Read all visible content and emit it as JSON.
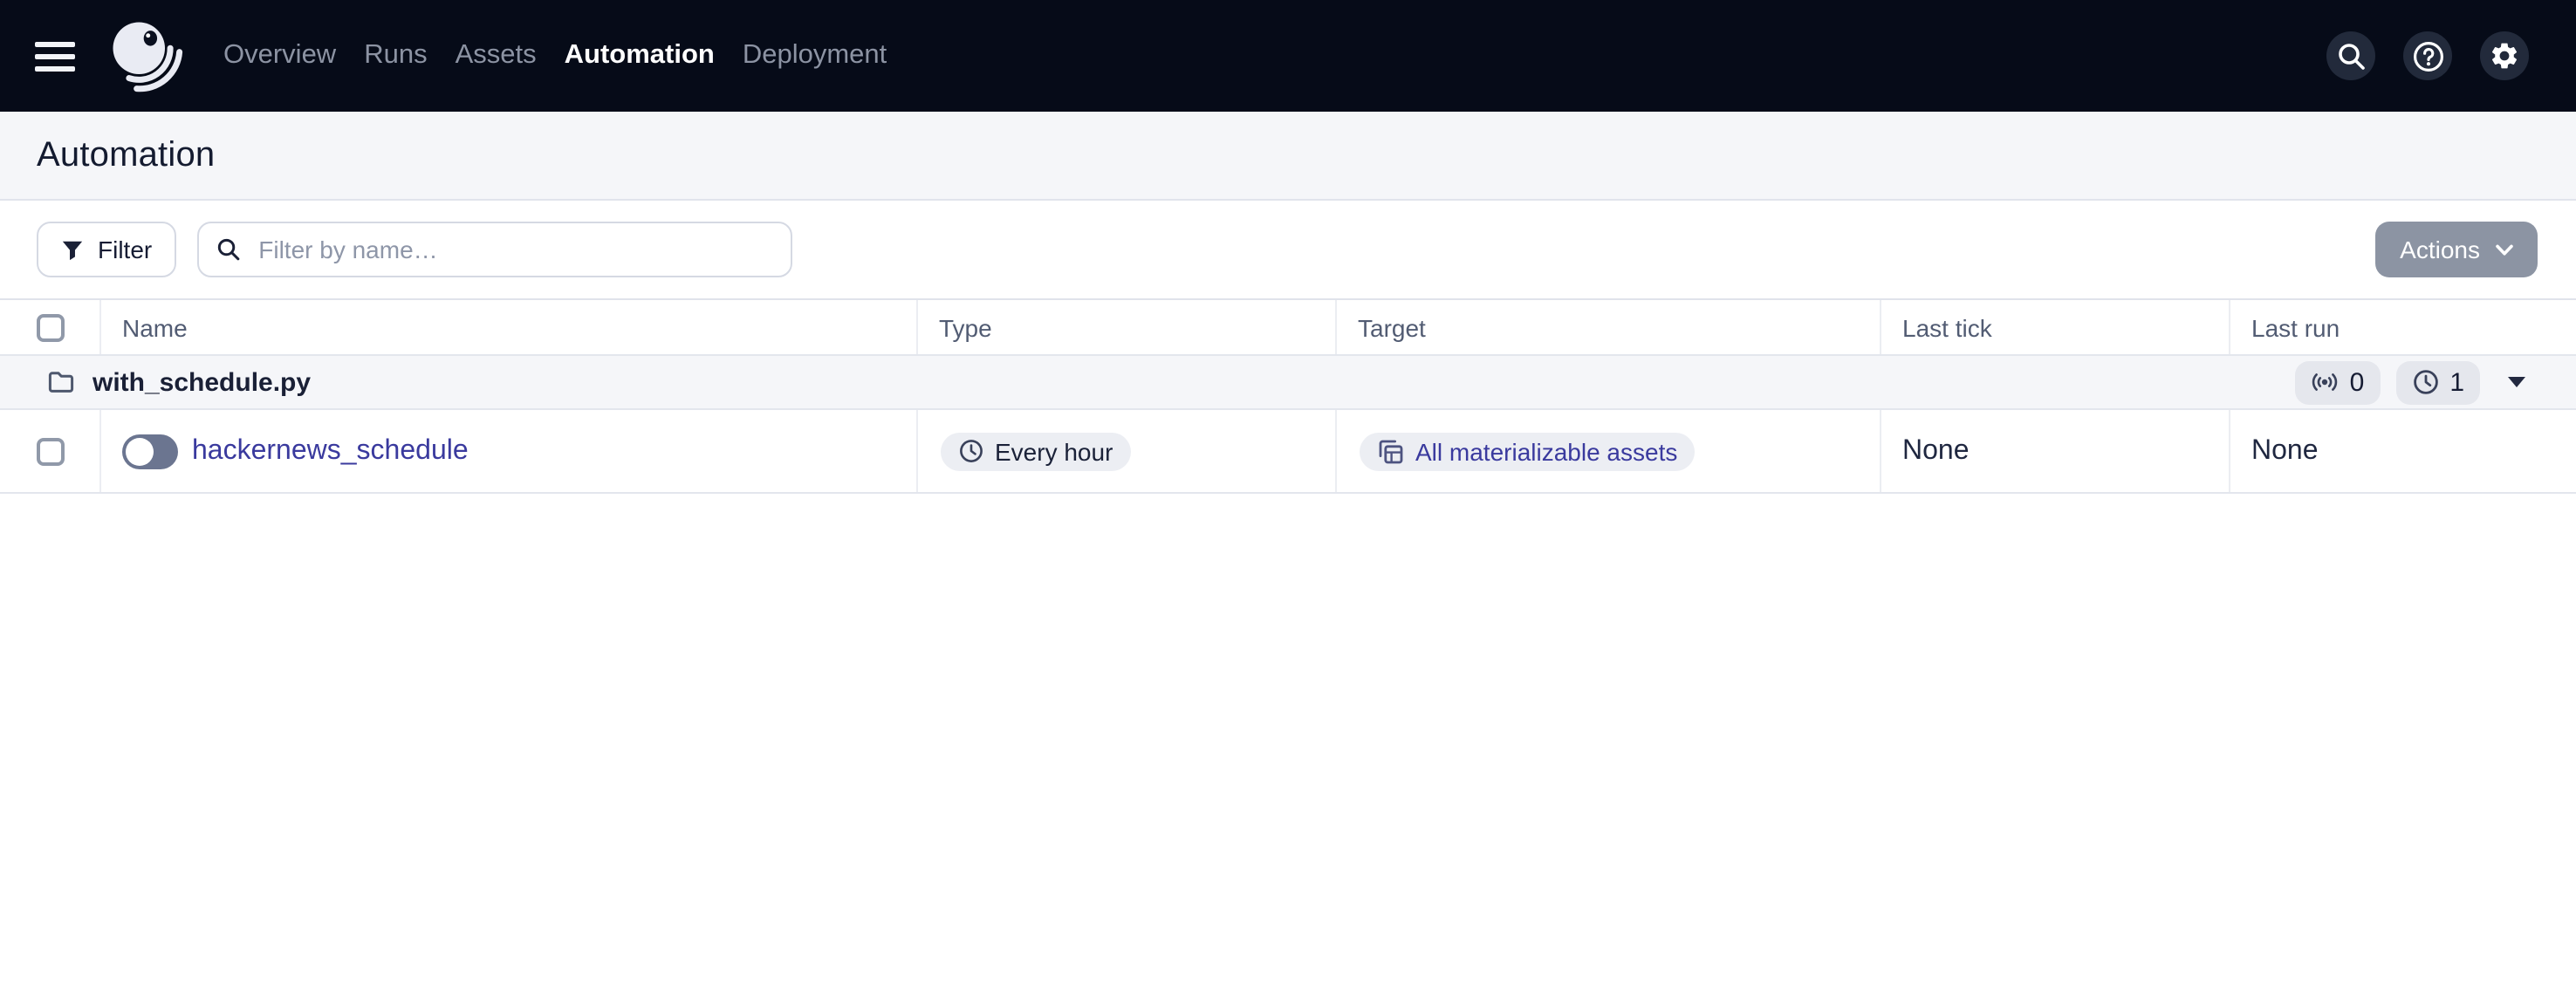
{
  "colors": {
    "topnav_bg": "#060B18",
    "band_bg": "#F5F6F9",
    "link": "#3A3A9E",
    "actions_bg": "#8C94A3",
    "toggle_track": "#6B7590"
  },
  "topnav": {
    "items": [
      {
        "label": "Overview",
        "active": false
      },
      {
        "label": "Runs",
        "active": false
      },
      {
        "label": "Assets",
        "active": false
      },
      {
        "label": "Automation",
        "active": true
      },
      {
        "label": "Deployment",
        "active": false
      }
    ],
    "icon_buttons": [
      "search-icon",
      "help-icon",
      "settings-icon"
    ]
  },
  "page": {
    "title": "Automation"
  },
  "toolbar": {
    "filter_label": "Filter",
    "search_placeholder": "Filter by name…",
    "search_value": "",
    "actions_label": "Actions"
  },
  "table": {
    "columns": [
      "",
      "Name",
      "Type",
      "Target",
      "Last tick",
      "Last run"
    ],
    "group": {
      "name": "with_schedule.py",
      "sensor_count": "0",
      "schedule_count": "1",
      "icons": [
        "folder-icon",
        "sensor-icon",
        "clock-icon",
        "caret-down-icon"
      ]
    },
    "rows": [
      {
        "name": "hackernews_schedule",
        "enabled": false,
        "type": "Every hour",
        "target": "All materializable assets",
        "last_tick": "None",
        "last_run": "None"
      }
    ]
  }
}
